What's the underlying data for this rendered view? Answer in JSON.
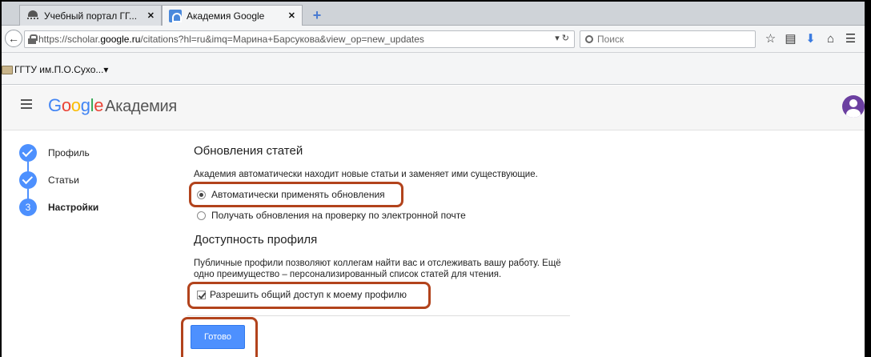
{
  "browser": {
    "tabs": [
      {
        "label": "Учебный портал ГГ...",
        "active": false
      },
      {
        "label": "Академия Google",
        "active": true
      }
    ],
    "url": {
      "prefix": "https://scholar.",
      "host": "google.ru",
      "rest": "/citations?hl=ru&imq=Марина+Барсукова&view_op=new_updates"
    },
    "search_placeholder": "Поиск",
    "bookmark": "ГГТУ им.П.О.Сухо..."
  },
  "header": {
    "brand": "Google",
    "product": "Академия"
  },
  "steps": [
    {
      "label": "Профиль",
      "state": "done"
    },
    {
      "label": "Статьи",
      "state": "done"
    },
    {
      "label": "Настройки",
      "state": "current",
      "number": "3"
    }
  ],
  "updates": {
    "title": "Обновления статей",
    "description": "Академия автоматически находит новые статьи и заменяет ими существующие.",
    "options": [
      {
        "label": "Автоматически применять обновления",
        "selected": true
      },
      {
        "label": "Получать обновления на проверку по электронной почте",
        "selected": false
      }
    ]
  },
  "visibility": {
    "title": "Доступность профиля",
    "description_line1": "Публичные профили позволяют коллегам найти вас и отслеживать вашу работу. Ещё",
    "description_line2": "одно преимущество – персонализированный список статей для чтения.",
    "checkbox_label": "Разрешить общий доступ к моему профилю",
    "checked": true
  },
  "done_button": "Готово",
  "colors": {
    "accent": "#4d90fe",
    "highlight": "#b2431c"
  }
}
